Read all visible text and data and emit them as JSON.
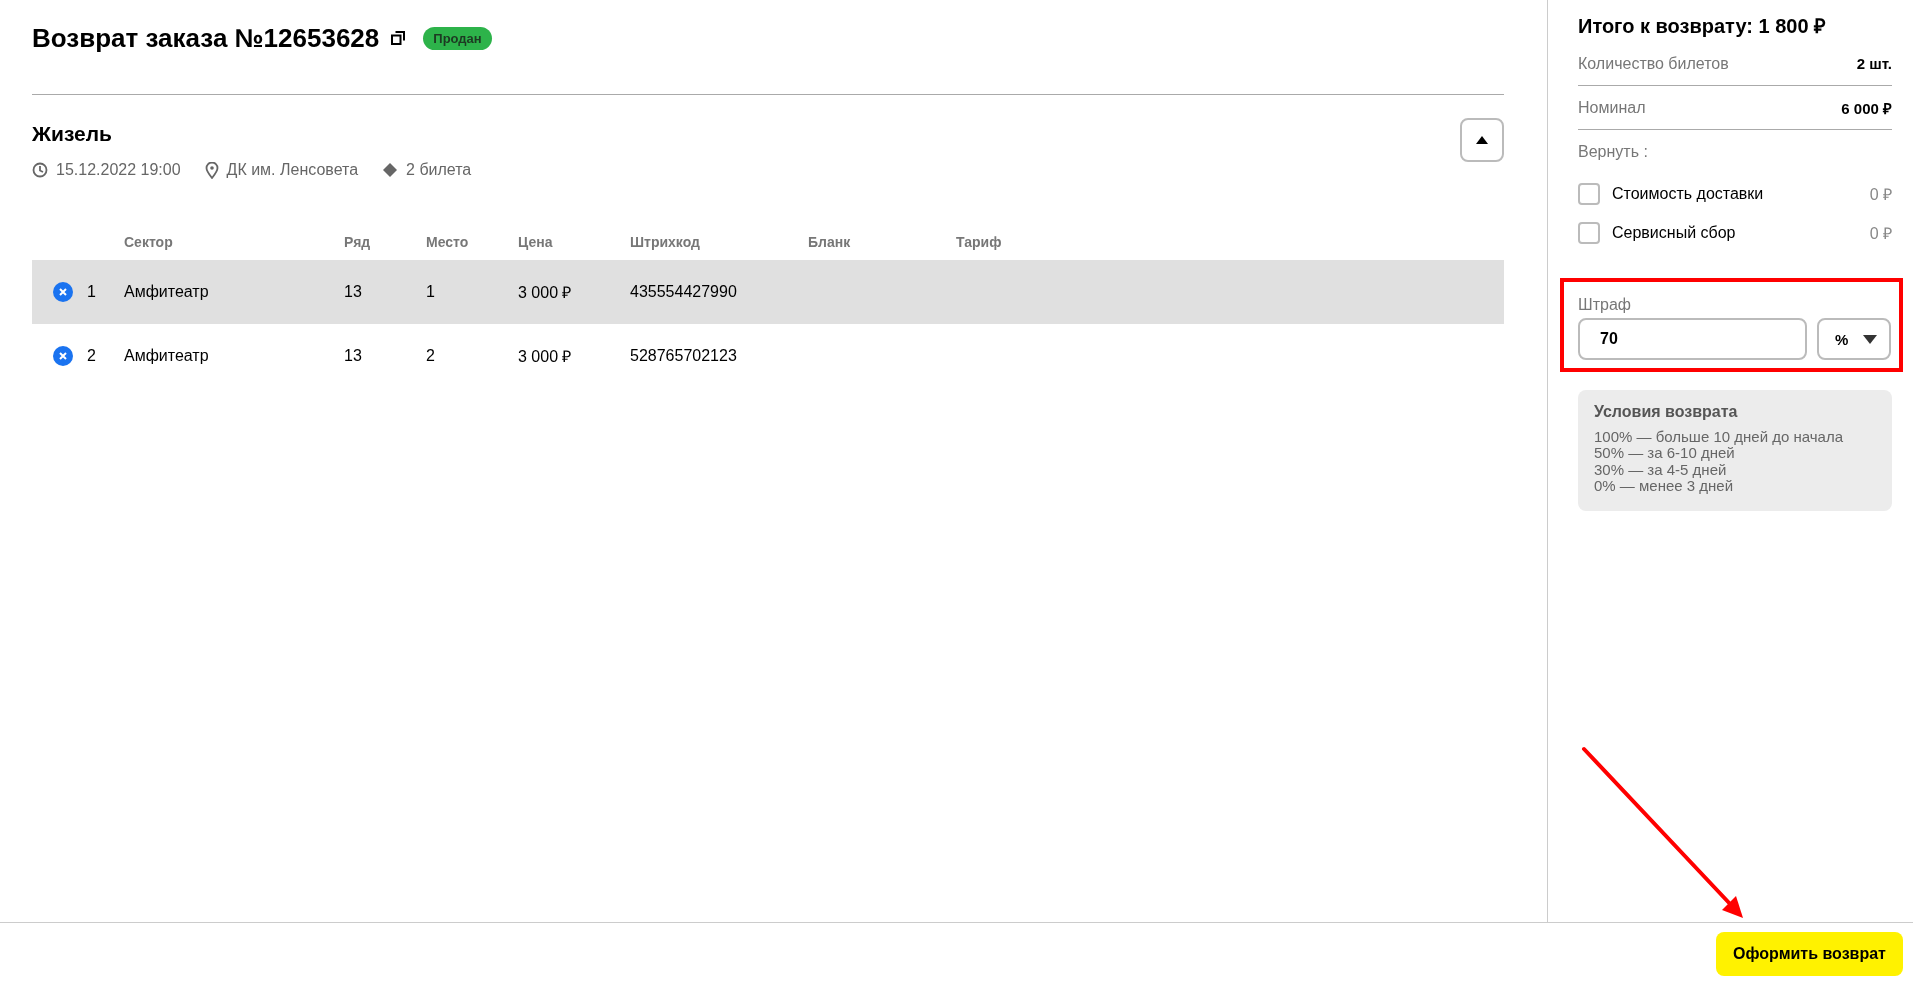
{
  "header": {
    "title": "Возврат заказа №12653628",
    "status": "Продан"
  },
  "event": {
    "name": "Жизель",
    "datetime": "15.12.2022 19:00",
    "venue": "ДК им. Ленсовета",
    "tickets_count": "2 билета",
    "expanded": true
  },
  "table": {
    "columns": [
      "Сектор",
      "Ряд",
      "Место",
      "Цена",
      "Штрихкод",
      "Бланк",
      "Тариф"
    ],
    "rows": [
      {
        "number": "1",
        "cells": [
          "Амфитеатр",
          "13",
          "1",
          "3 000 ₽",
          "435554427990"
        ],
        "selected": true
      },
      {
        "number": "2",
        "cells": [
          "Амфитеатр",
          "13",
          "2",
          "3 000 ₽",
          "528765702123"
        ],
        "selected": false
      }
    ]
  },
  "summary": {
    "title": "Итого к возврату: 1 800 ₽",
    "lines": [
      {
        "label": "Количество билетов",
        "value": "2 шт."
      },
      {
        "label": "Номинал",
        "value": "6 000 ₽"
      }
    ],
    "refund_label": "Вернуть :",
    "refund_options": [
      {
        "label": "Стоимость доставки",
        "amount": "0 ₽",
        "checked": false
      },
      {
        "label": "Сервисный сбор",
        "amount": "0 ₽",
        "checked": false
      }
    ],
    "penalty": {
      "label": "Штраф",
      "value": "70",
      "unit": "%"
    },
    "conditions": {
      "title": "Условия возврата",
      "lines": [
        "100% — больше 10 дней до начала",
        "50% — за 6-10 дней",
        "30% — за 4-5 дней",
        "0% — менее 3 дней"
      ]
    }
  },
  "footer": {
    "submit": "Оформить возврат"
  }
}
